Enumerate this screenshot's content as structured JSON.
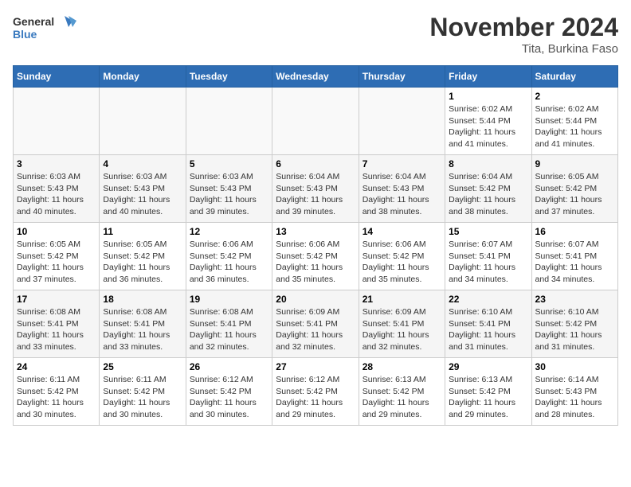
{
  "logo": {
    "line1": "General",
    "line2": "Blue"
  },
  "title": "November 2024",
  "subtitle": "Tita, Burkina Faso",
  "days_of_week": [
    "Sunday",
    "Monday",
    "Tuesday",
    "Wednesday",
    "Thursday",
    "Friday",
    "Saturday"
  ],
  "weeks": [
    [
      {
        "day": "",
        "info": ""
      },
      {
        "day": "",
        "info": ""
      },
      {
        "day": "",
        "info": ""
      },
      {
        "day": "",
        "info": ""
      },
      {
        "day": "",
        "info": ""
      },
      {
        "day": "1",
        "info": "Sunrise: 6:02 AM\nSunset: 5:44 PM\nDaylight: 11 hours and 41 minutes."
      },
      {
        "day": "2",
        "info": "Sunrise: 6:02 AM\nSunset: 5:44 PM\nDaylight: 11 hours and 41 minutes."
      }
    ],
    [
      {
        "day": "3",
        "info": "Sunrise: 6:03 AM\nSunset: 5:43 PM\nDaylight: 11 hours and 40 minutes."
      },
      {
        "day": "4",
        "info": "Sunrise: 6:03 AM\nSunset: 5:43 PM\nDaylight: 11 hours and 40 minutes."
      },
      {
        "day": "5",
        "info": "Sunrise: 6:03 AM\nSunset: 5:43 PM\nDaylight: 11 hours and 39 minutes."
      },
      {
        "day": "6",
        "info": "Sunrise: 6:04 AM\nSunset: 5:43 PM\nDaylight: 11 hours and 39 minutes."
      },
      {
        "day": "7",
        "info": "Sunrise: 6:04 AM\nSunset: 5:43 PM\nDaylight: 11 hours and 38 minutes."
      },
      {
        "day": "8",
        "info": "Sunrise: 6:04 AM\nSunset: 5:42 PM\nDaylight: 11 hours and 38 minutes."
      },
      {
        "day": "9",
        "info": "Sunrise: 6:05 AM\nSunset: 5:42 PM\nDaylight: 11 hours and 37 minutes."
      }
    ],
    [
      {
        "day": "10",
        "info": "Sunrise: 6:05 AM\nSunset: 5:42 PM\nDaylight: 11 hours and 37 minutes."
      },
      {
        "day": "11",
        "info": "Sunrise: 6:05 AM\nSunset: 5:42 PM\nDaylight: 11 hours and 36 minutes."
      },
      {
        "day": "12",
        "info": "Sunrise: 6:06 AM\nSunset: 5:42 PM\nDaylight: 11 hours and 36 minutes."
      },
      {
        "day": "13",
        "info": "Sunrise: 6:06 AM\nSunset: 5:42 PM\nDaylight: 11 hours and 35 minutes."
      },
      {
        "day": "14",
        "info": "Sunrise: 6:06 AM\nSunset: 5:42 PM\nDaylight: 11 hours and 35 minutes."
      },
      {
        "day": "15",
        "info": "Sunrise: 6:07 AM\nSunset: 5:41 PM\nDaylight: 11 hours and 34 minutes."
      },
      {
        "day": "16",
        "info": "Sunrise: 6:07 AM\nSunset: 5:41 PM\nDaylight: 11 hours and 34 minutes."
      }
    ],
    [
      {
        "day": "17",
        "info": "Sunrise: 6:08 AM\nSunset: 5:41 PM\nDaylight: 11 hours and 33 minutes."
      },
      {
        "day": "18",
        "info": "Sunrise: 6:08 AM\nSunset: 5:41 PM\nDaylight: 11 hours and 33 minutes."
      },
      {
        "day": "19",
        "info": "Sunrise: 6:08 AM\nSunset: 5:41 PM\nDaylight: 11 hours and 32 minutes."
      },
      {
        "day": "20",
        "info": "Sunrise: 6:09 AM\nSunset: 5:41 PM\nDaylight: 11 hours and 32 minutes."
      },
      {
        "day": "21",
        "info": "Sunrise: 6:09 AM\nSunset: 5:41 PM\nDaylight: 11 hours and 32 minutes."
      },
      {
        "day": "22",
        "info": "Sunrise: 6:10 AM\nSunset: 5:41 PM\nDaylight: 11 hours and 31 minutes."
      },
      {
        "day": "23",
        "info": "Sunrise: 6:10 AM\nSunset: 5:42 PM\nDaylight: 11 hours and 31 minutes."
      }
    ],
    [
      {
        "day": "24",
        "info": "Sunrise: 6:11 AM\nSunset: 5:42 PM\nDaylight: 11 hours and 30 minutes."
      },
      {
        "day": "25",
        "info": "Sunrise: 6:11 AM\nSunset: 5:42 PM\nDaylight: 11 hours and 30 minutes."
      },
      {
        "day": "26",
        "info": "Sunrise: 6:12 AM\nSunset: 5:42 PM\nDaylight: 11 hours and 30 minutes."
      },
      {
        "day": "27",
        "info": "Sunrise: 6:12 AM\nSunset: 5:42 PM\nDaylight: 11 hours and 29 minutes."
      },
      {
        "day": "28",
        "info": "Sunrise: 6:13 AM\nSunset: 5:42 PM\nDaylight: 11 hours and 29 minutes."
      },
      {
        "day": "29",
        "info": "Sunrise: 6:13 AM\nSunset: 5:42 PM\nDaylight: 11 hours and 29 minutes."
      },
      {
        "day": "30",
        "info": "Sunrise: 6:14 AM\nSunset: 5:43 PM\nDaylight: 11 hours and 28 minutes."
      }
    ]
  ]
}
